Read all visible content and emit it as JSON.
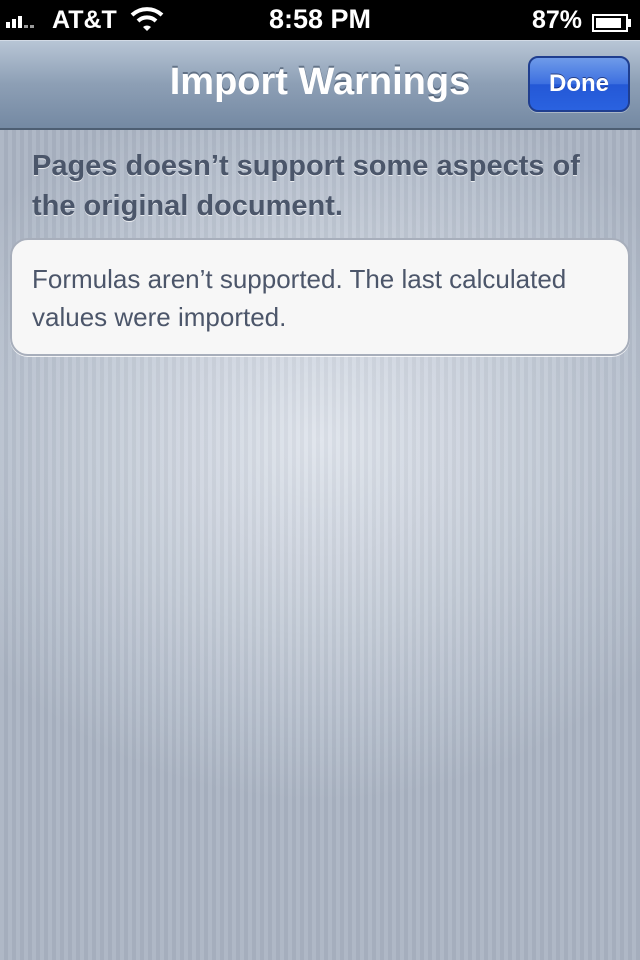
{
  "status_bar": {
    "carrier": "AT&T",
    "time": "8:58 PM",
    "battery_percent": "87%"
  },
  "nav_bar": {
    "title": "Import Warnings",
    "done_label": "Done"
  },
  "content": {
    "header": "Pages doesn’t support some aspects of the original document.",
    "warnings": [
      "Formulas aren’t supported. The last calculated values were imported."
    ]
  },
  "colors": {
    "accent_button": "#2a62e0",
    "nav_bar": "#8d9fb5",
    "text": "#4c566a"
  },
  "icons": [
    "signal-icon",
    "wifi-icon",
    "battery-icon"
  ]
}
